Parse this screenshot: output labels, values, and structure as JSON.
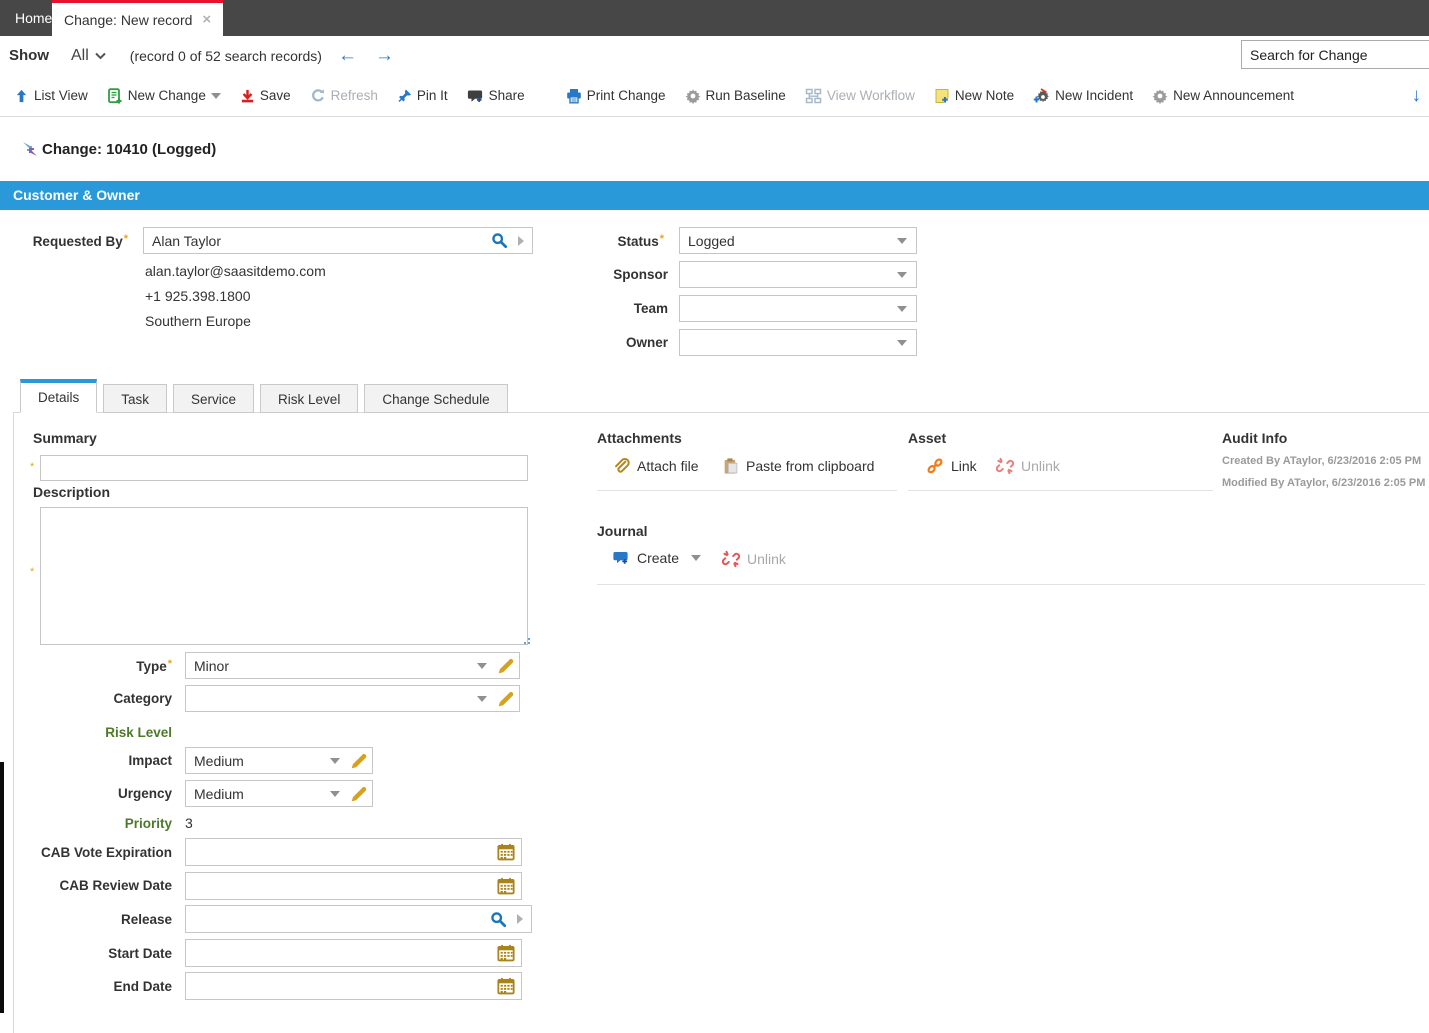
{
  "window": {
    "home_tab": "Home",
    "active_tab": "Change: New record",
    "close_icon": "×"
  },
  "show_bar": {
    "show_label": "Show",
    "filter_value": "All",
    "record_info": "(record 0 of 52 search records)",
    "prev_arrow": "←",
    "next_arrow": "→",
    "search_value": "Search for Change"
  },
  "toolbar": {
    "list_view": "List View",
    "new_change": "New Change",
    "save": "Save",
    "refresh": "Refresh",
    "pin_it": "Pin It",
    "share": "Share",
    "print_change": "Print Change",
    "run_baseline": "Run Baseline",
    "view_workflow": "View Workflow",
    "new_note": "New Note",
    "new_incident": "New Incident",
    "new_announcement": "New Announcement",
    "overflow_arrow": "↓"
  },
  "record": {
    "title": "Change: 10410 (Logged)"
  },
  "customer_owner": {
    "section_title": "Customer & Owner",
    "requested_by": {
      "label": "Requested By",
      "value": "Alan Taylor",
      "email": "alan.taylor@saasitdemo.com",
      "phone": "+1 925.398.1800",
      "region": "Southern Europe"
    },
    "status": {
      "label": "Status",
      "value": "Logged"
    },
    "sponsor": {
      "label": "Sponsor",
      "value": ""
    },
    "team": {
      "label": "Team",
      "value": ""
    },
    "owner": {
      "label": "Owner",
      "value": ""
    }
  },
  "detail_tabs": {
    "items": [
      {
        "label": "Details"
      },
      {
        "label": "Task"
      },
      {
        "label": "Service"
      },
      {
        "label": "Risk Level"
      },
      {
        "label": "Change Schedule"
      }
    ]
  },
  "details": {
    "summary_label": "Summary",
    "description_label": "Description",
    "type": {
      "label": "Type",
      "value": "Minor"
    },
    "category": {
      "label": "Category",
      "value": ""
    },
    "risk_level_label": "Risk Level",
    "impact": {
      "label": "Impact",
      "value": "Medium"
    },
    "urgency": {
      "label": "Urgency",
      "value": "Medium"
    },
    "priority": {
      "label": "Priority",
      "value": "3"
    },
    "cab_vote_expiration": {
      "label": "CAB Vote Expiration"
    },
    "cab_review_date": {
      "label": "CAB Review Date"
    },
    "release": {
      "label": "Release"
    },
    "start_date": {
      "label": "Start Date"
    },
    "end_date": {
      "label": "End Date"
    }
  },
  "attachments": {
    "title": "Attachments",
    "attach_file": "Attach file",
    "paste_from_clipboard": "Paste from clipboard"
  },
  "asset": {
    "title": "Asset",
    "link": "Link",
    "unlink": "Unlink"
  },
  "audit_info": {
    "title": "Audit Info",
    "created": "Created By ATaylor, 6/23/2016 2:05 PM",
    "modified": "Modified By ATaylor, 6/23/2016 2:05 PM"
  },
  "journal": {
    "title": "Journal",
    "create": "Create",
    "unlink": "Unlink"
  },
  "colors": {
    "accent_blue": "#2999d9",
    "tab_red": "#e8112d",
    "label_green": "#4c7a2a",
    "icon_gold": "#b5891c",
    "required_orange": "#f0a020",
    "link_orange": "#f07d1a",
    "unlink_red": "#e25858"
  }
}
